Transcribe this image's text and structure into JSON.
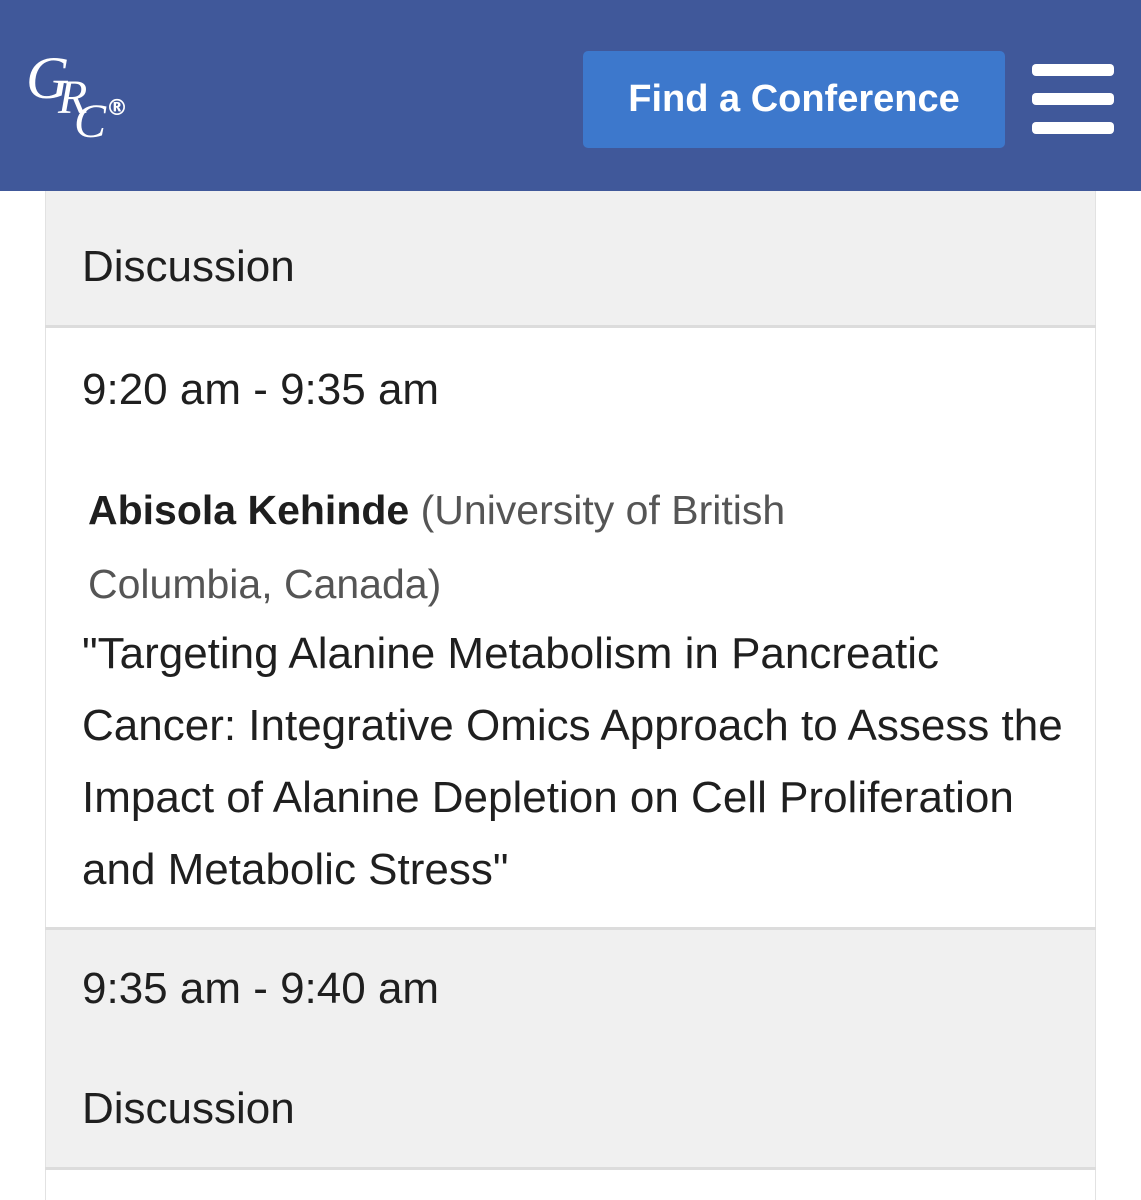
{
  "header": {
    "logo_letters": [
      "G",
      "R",
      "C"
    ],
    "logo_registered": "®",
    "find_conference_label": "Find a Conference",
    "menu_icon": "hamburger-menu-icon",
    "background_color": "#40589a",
    "button_color": "#3d78cc"
  },
  "schedule": {
    "item1": {
      "title": "Discussion"
    },
    "item2": {
      "time": "9:20 am - 9:35 am",
      "speaker_name": "Abisola Kehinde",
      "affiliation": "(University of British Columbia, Canada)",
      "talk_title": "\"Targeting Alanine Metabolism in Pancreatic Cancer: Integrative Omics Approach to Assess the Impact of Alanine Depletion on Cell Proliferation and Metabolic Stress\""
    },
    "item3": {
      "time": "9:35 am - 9:40 am",
      "title": "Discussion"
    }
  }
}
